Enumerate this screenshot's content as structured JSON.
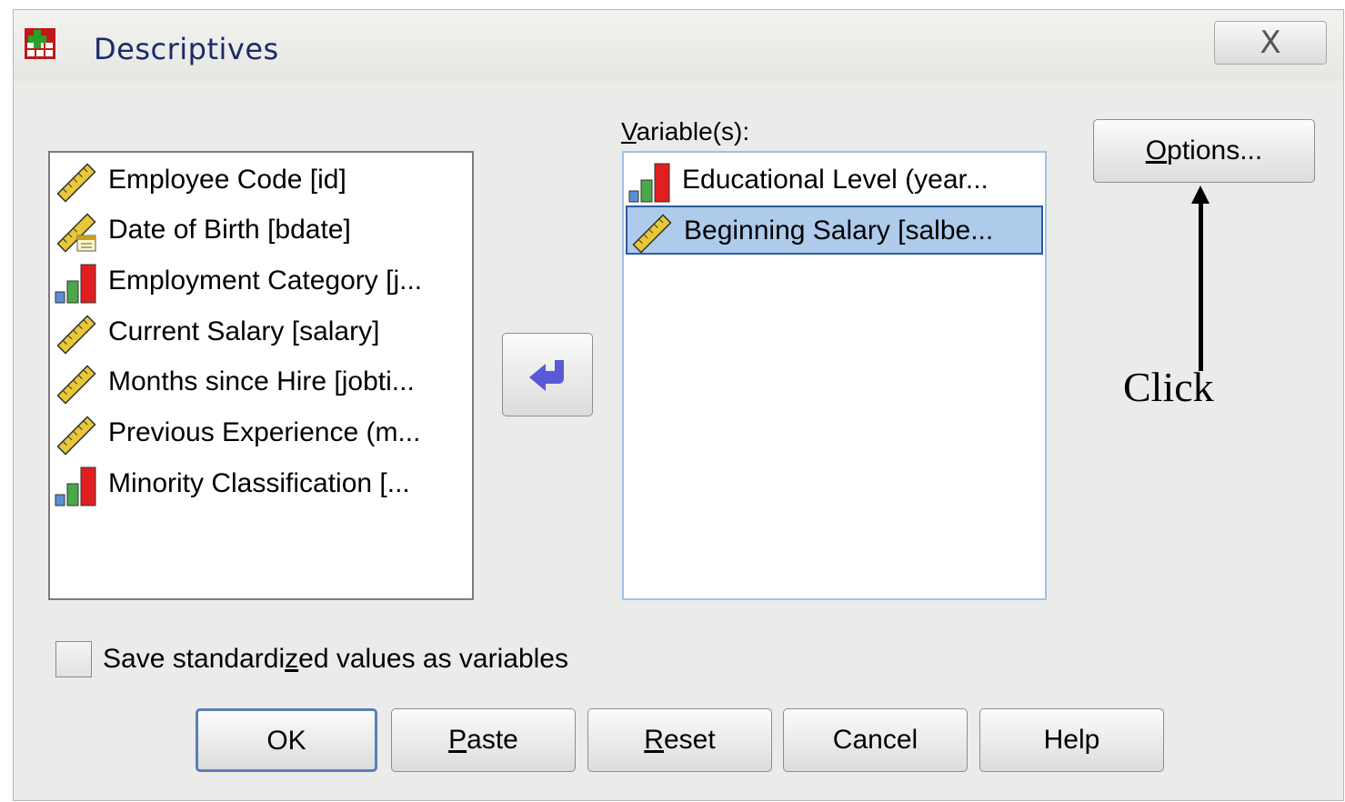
{
  "window": {
    "title": "Descriptives",
    "close_label": "X"
  },
  "source_list": {
    "items": [
      {
        "label": "Employee Code [id]",
        "icon": "scale-ruler-icon"
      },
      {
        "label": "Date of Birth [bdate]",
        "icon": "date-ruler-icon"
      },
      {
        "label": "Employment Category [j...",
        "icon": "nominal-bar-icon"
      },
      {
        "label": "Current Salary [salary]",
        "icon": "scale-ruler-icon"
      },
      {
        "label": "Months since Hire [jobti...",
        "icon": "scale-ruler-icon"
      },
      {
        "label": "Previous Experience (m...",
        "icon": "scale-ruler-icon"
      },
      {
        "label": "Minority Classification [...",
        "icon": "nominal-bar-icon"
      }
    ]
  },
  "variables": {
    "label_prefix": "V",
    "label_rest": "ariable(s):",
    "items": [
      {
        "label": "Educational Level (year...",
        "icon": "nominal-bar-icon",
        "selected": false
      },
      {
        "label": "Beginning Salary [salbe...",
        "icon": "scale-ruler-icon",
        "selected": true
      }
    ]
  },
  "buttons": {
    "options_prefix": "O",
    "options_rest": "ptions...",
    "move_icon": "move-left-arrow-icon",
    "ok": "OK",
    "paste_prefix": "P",
    "paste_rest": "aste",
    "reset_prefix": "R",
    "reset_rest": "eset",
    "cancel": "Cancel",
    "help": "Help"
  },
  "checkbox": {
    "label_a": "Save standardi",
    "label_u": "z",
    "label_b": "ed values as variables",
    "checked": false
  },
  "annotation": {
    "text": "Click"
  }
}
